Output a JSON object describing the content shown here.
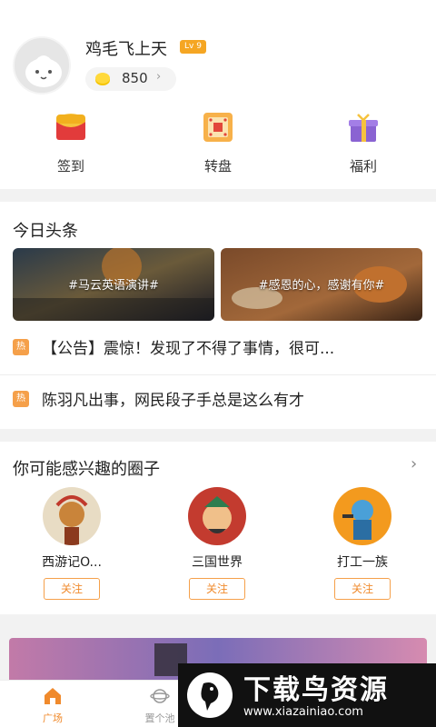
{
  "profile": {
    "username": "鸡毛飞上天",
    "level": "Lv 9",
    "coins": "850",
    "coin_arrow": "›"
  },
  "quick_actions": [
    {
      "label": "签到",
      "icon": "red-envelope-icon"
    },
    {
      "label": "转盘",
      "icon": "wheel-icon"
    },
    {
      "label": "福利",
      "icon": "gift-icon"
    }
  ],
  "headlines": {
    "title": "今日头条",
    "banners": [
      {
        "label": "#马云英语演讲#"
      },
      {
        "label": "#感恩的心，感谢有你#"
      }
    ],
    "news": [
      {
        "tag": "热",
        "text": "【公告】震惊！发现了不得了事情，很可..."
      },
      {
        "tag": "热",
        "text": "陈羽凡出事，网民段子手总是这么有才"
      }
    ]
  },
  "circles": {
    "title": "你可能感兴趣的圈子",
    "more": "›",
    "items": [
      {
        "name": "西游记O...",
        "follow": "关注"
      },
      {
        "name": "三国世界",
        "follow": "关注"
      },
      {
        "name": "打工一族",
        "follow": "关注"
      }
    ]
  },
  "tabbar": [
    {
      "label": "广场",
      "active": true
    },
    {
      "label": "置个池",
      "active": false
    }
  ],
  "watermark": {
    "title": "下载鸟资源",
    "url": "www.xiazainiao.com"
  },
  "colors": {
    "accent": "#f08a2c",
    "badge": "#f5a623",
    "hot": "#f5a04a"
  }
}
